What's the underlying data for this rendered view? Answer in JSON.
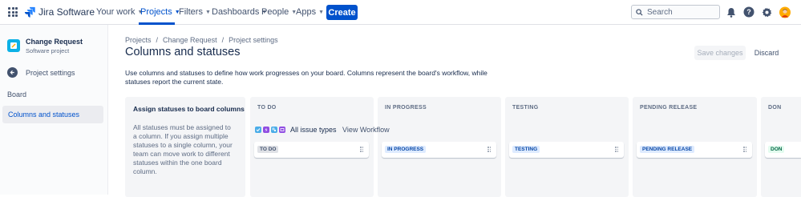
{
  "topnav": {
    "brand": "Jira Software",
    "items": [
      {
        "label": "Your work"
      },
      {
        "label": "Projects"
      },
      {
        "label": "Filters"
      },
      {
        "label": "Dashboards"
      },
      {
        "label": "People"
      },
      {
        "label": "Apps"
      }
    ],
    "create_label": "Create",
    "search_placeholder": "Search",
    "icons": [
      "app-switcher-icon",
      "notifications-icon",
      "help-icon",
      "settings-icon",
      "user-avatar"
    ]
  },
  "sidebar": {
    "project_name": "Change Request",
    "project_type": "Software project",
    "back_label": "Project settings",
    "section_label": "Board",
    "active_item": "Columns and statuses"
  },
  "main": {
    "breadcrumb": [
      "Projects",
      "/",
      "Change Request",
      "/",
      "Project settings"
    ],
    "title": "Columns and statuses",
    "save_label": "Save changes",
    "discard_label": "Discard",
    "description": "Use columns and statuses to define how work progresses on your board. Columns represent the board's workflow, while statuses report the current state.",
    "assign_title": "Assign statuses to board columns",
    "assign_text": "All statuses must be assigned to a column. If you assign multiple statuses to a single column, your team can move work to different statuses within the one board column.",
    "issue_types_label": "All issue types",
    "view_workflow_label": "View Workflow",
    "columns": [
      {
        "title": "TO DO",
        "status": "TO DO"
      },
      {
        "title": "IN PROGRESS",
        "status": "IN PROGRESS"
      },
      {
        "title": "TESTING",
        "status": "TESTING"
      },
      {
        "title": "PENDING RELEASE",
        "status": "PENDING RELEASE"
      },
      {
        "title": "DON",
        "status": "DON"
      }
    ]
  },
  "colors": {
    "primary": "#0052cc",
    "todo_lozenge_bg": "#dfe1e6",
    "todo_lozenge_text": "#42526e",
    "inprogress_lozenge_bg": "#deebff",
    "inprogress_lozenge_text": "#0747a6",
    "done_lozenge_bg": "#e3fcef",
    "done_lozenge_text": "#006644"
  }
}
